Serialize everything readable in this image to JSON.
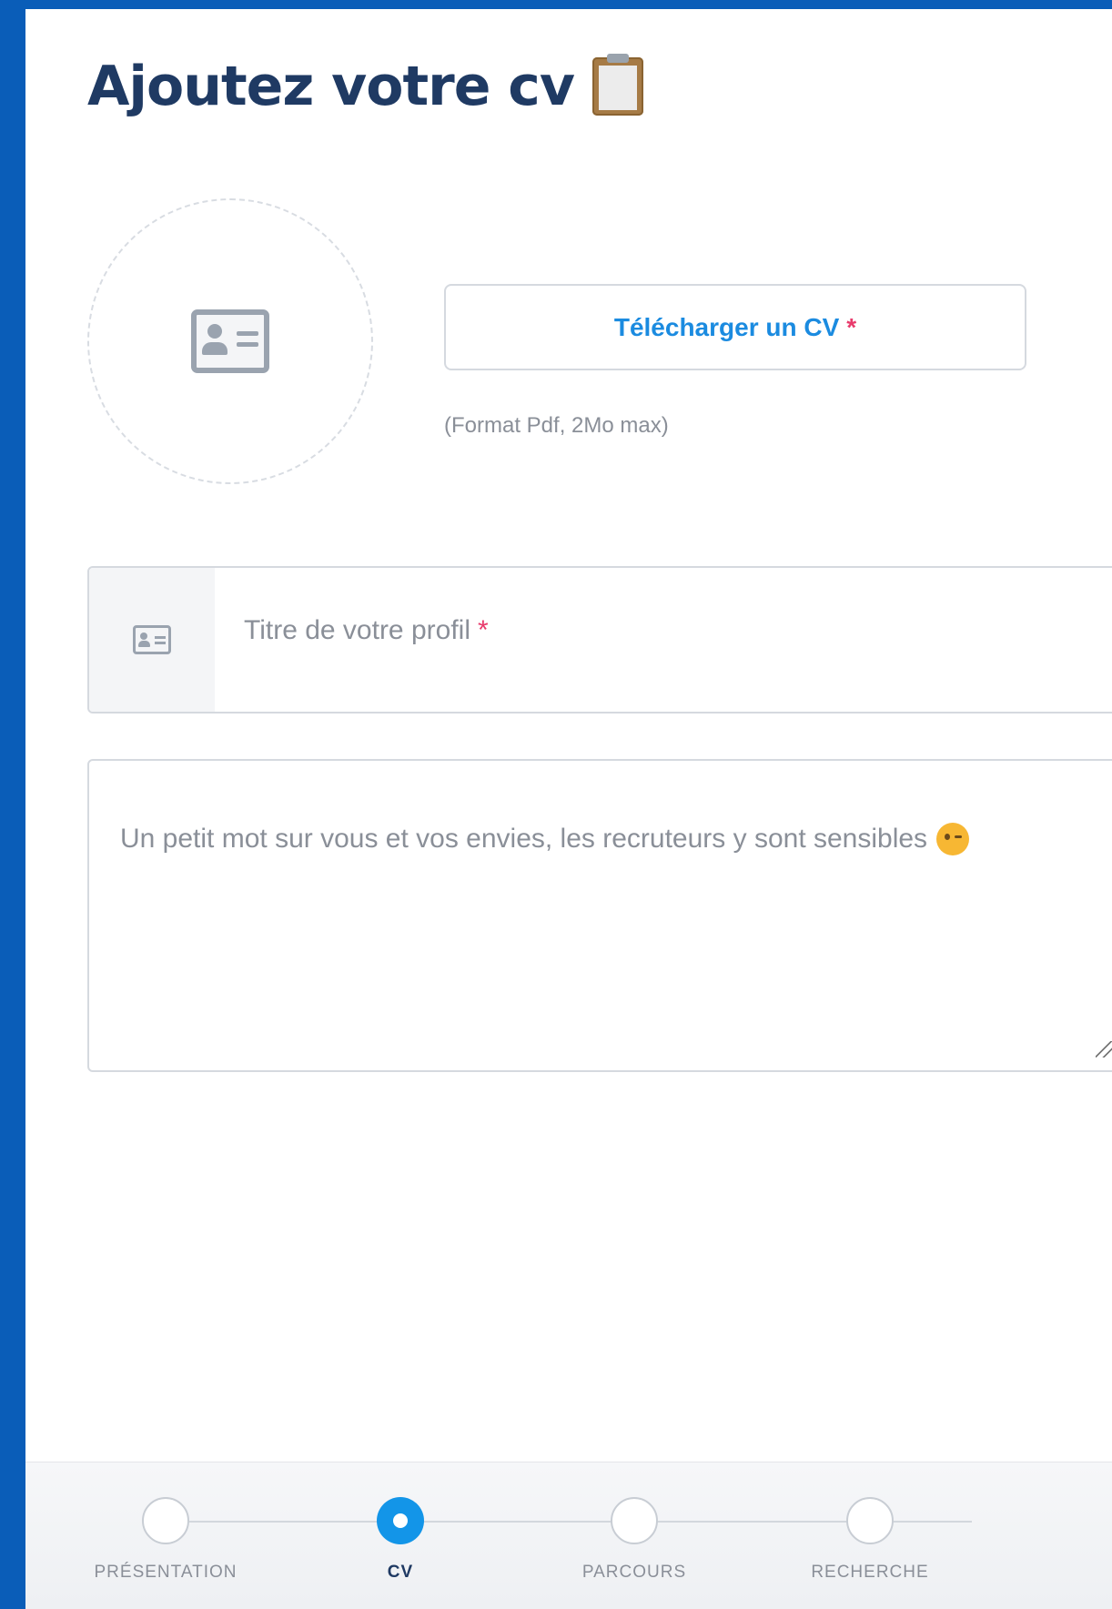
{
  "page": {
    "title": "Ajoutez votre cv",
    "title_icon": "clipboard-icon"
  },
  "upload": {
    "button_label": "Télécharger un CV",
    "required_mark": "*",
    "format_hint": "(Format Pdf, 2Mo max)",
    "avatar_icon": "id-card-icon"
  },
  "profile_title": {
    "placeholder": "Titre de votre profil",
    "required_mark": "*",
    "icon": "id-card-icon"
  },
  "about": {
    "placeholder": "Un petit mot sur vous et vos envies, les recruteurs y sont sensibles",
    "emoji": "wink-emoji"
  },
  "stepper": {
    "steps": [
      {
        "label": "PRÉSENTATION",
        "active": false
      },
      {
        "label": "CV",
        "active": true
      },
      {
        "label": "PARCOURS",
        "active": false
      },
      {
        "label": "RECHERCHE",
        "active": false
      }
    ]
  },
  "colors": {
    "frame": "#0a5db8",
    "title": "#1f3a63",
    "accent": "#1395e8",
    "required": "#e83b6c"
  }
}
